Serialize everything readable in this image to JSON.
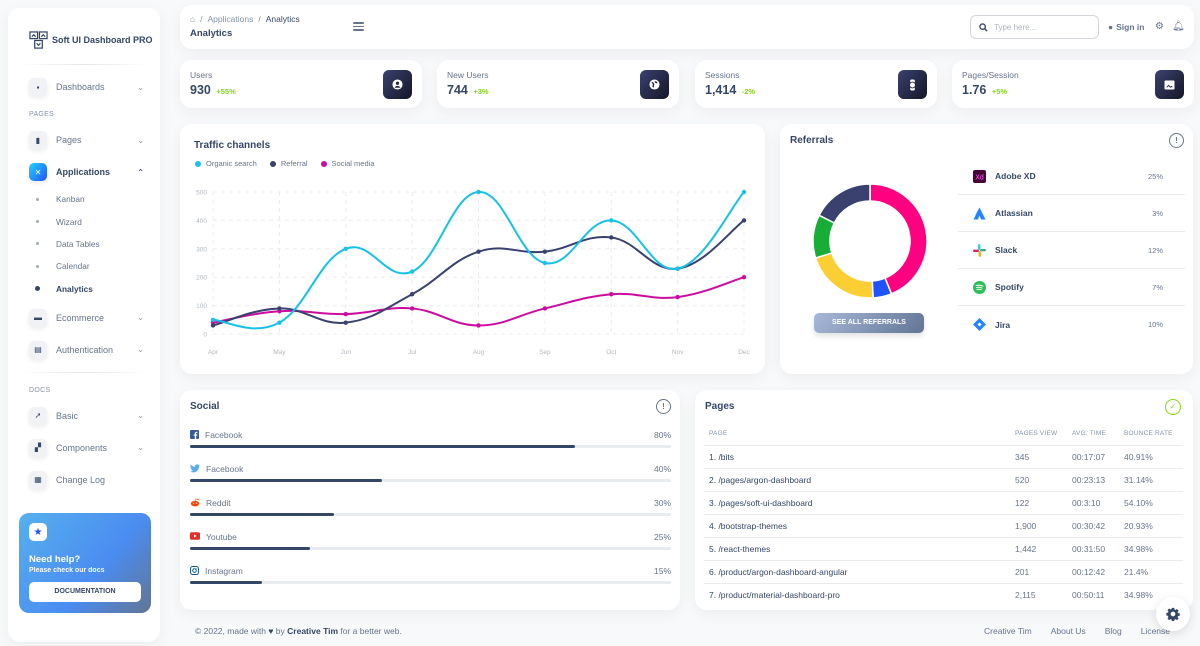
{
  "sidebar": {
    "brand": "Soft UI Dashboard PRO",
    "items_top": [
      {
        "label": "Dashboards",
        "icon": "shop-icon"
      }
    ],
    "section_pages": "PAGES",
    "pages_item": {
      "label": "Pages",
      "icon": "chart-icon"
    },
    "applications": {
      "label": "Applications",
      "icon": "tools-icon"
    },
    "applications_sub": [
      "Kanban",
      "Wizard",
      "Data Tables",
      "Calendar",
      "Analytics"
    ],
    "active_sub": "Analytics",
    "ecommerce": {
      "label": "Ecommerce",
      "icon": "basket-icon"
    },
    "authentication": {
      "label": "Authentication",
      "icon": "document-icon"
    },
    "section_docs": "DOCS",
    "basic": {
      "label": "Basic",
      "icon": "rocket-icon"
    },
    "components": {
      "label": "Components",
      "icon": "components-icon"
    },
    "changelog": {
      "label": "Change Log",
      "icon": "changelog-icon"
    },
    "help": {
      "title": "Need help?",
      "subtitle": "Please check our docs",
      "button": "DOCUMENTATION"
    }
  },
  "navbar": {
    "breadcrumb_parent": "Applications",
    "breadcrumb_current": "Analytics",
    "title": "Analytics",
    "search_placeholder": "Type here...",
    "signin": "Sign in"
  },
  "stats": [
    {
      "label": "Users",
      "value": "930",
      "change": "+55%",
      "icon": "user-icon"
    },
    {
      "label": "New Users",
      "value": "744",
      "change": "+3%",
      "icon": "globe-icon"
    },
    {
      "label": "Sessions",
      "value": "1,414",
      "change": "-2%",
      "icon": "watch-icon"
    },
    {
      "label": "Pages/Session",
      "value": "1.76",
      "change": "+5%",
      "icon": "image-icon"
    }
  ],
  "traffic": {
    "title": "Traffic channels"
  },
  "chart_data": {
    "type": "line",
    "title": "Traffic channels",
    "xlabel": "",
    "ylabel": "",
    "categories": [
      "Apr",
      "May",
      "Jun",
      "Jul",
      "Aug",
      "Sep",
      "Oct",
      "Nov",
      "Dec"
    ],
    "ylim": [
      0,
      500
    ],
    "yticks": [
      0,
      100,
      200,
      300,
      400,
      500
    ],
    "grid": true,
    "legend": "top-left",
    "series": [
      {
        "name": "Organic search",
        "color": "#17c1e8",
        "values": [
          50,
          40,
          300,
          220,
          500,
          250,
          400,
          230,
          500
        ]
      },
      {
        "name": "Referral",
        "color": "#3a416f",
        "values": [
          30,
          90,
          40,
          140,
          290,
          290,
          340,
          230,
          400
        ]
      },
      {
        "name": "Social media",
        "color": "#cb0c9f",
        "values": [
          40,
          80,
          70,
          90,
          30,
          90,
          140,
          130,
          200
        ]
      }
    ]
  },
  "referrals": {
    "title": "Referrals",
    "button": "SEE ALL REFERRALS",
    "donut": {
      "type": "pie",
      "values": [
        25,
        3,
        12,
        7,
        10
      ],
      "colors": [
        "#ff0080",
        "#2152ff",
        "#fbcf33",
        "#17ad37",
        "#3a416f"
      ]
    },
    "items": [
      {
        "name": "Adobe XD",
        "pct": "25%",
        "icon": "adobe-xd-icon"
      },
      {
        "name": "Atlassian",
        "pct": "3%",
        "icon": "atlassian-icon"
      },
      {
        "name": "Slack",
        "pct": "12%",
        "icon": "slack-icon"
      },
      {
        "name": "Spotify",
        "pct": "7%",
        "icon": "spotify-icon"
      },
      {
        "name": "Jira",
        "pct": "10%",
        "icon": "jira-icon"
      }
    ]
  },
  "social": {
    "title": "Social",
    "items": [
      {
        "name": "Facebook",
        "pct": "80%",
        "value": 80,
        "icon": "facebook-icon"
      },
      {
        "name": "Facebook",
        "pct": "40%",
        "value": 40,
        "icon": "twitter-icon"
      },
      {
        "name": "Reddit",
        "pct": "30%",
        "value": 30,
        "icon": "reddit-icon"
      },
      {
        "name": "Youtube",
        "pct": "25%",
        "value": 25,
        "icon": "youtube-icon"
      },
      {
        "name": "Instagram",
        "pct": "15%",
        "value": 15,
        "icon": "instagram-icon"
      }
    ]
  },
  "pages": {
    "title": "Pages",
    "headers": [
      "PAGE",
      "PAGES VIEW",
      "AVG. TIME",
      "BOUNCE RATE"
    ],
    "rows": [
      [
        "1. /bits",
        "345",
        "00:17:07",
        "40.91%"
      ],
      [
        "2. /pages/argon-dashboard",
        "520",
        "00:23:13",
        "31.14%"
      ],
      [
        "3. /pages/soft-ui-dashboard",
        "122",
        "00:3:10",
        "54.10%"
      ],
      [
        "4. /bootstrap-themes",
        "1,900",
        "00:30:42",
        "20.93%"
      ],
      [
        "5. /react-themes",
        "1,442",
        "00:31:50",
        "34.98%"
      ],
      [
        "6. /product/argon-dashboard-angular",
        "201",
        "00:12:42",
        "21.4%"
      ],
      [
        "7. /product/material-dashboard-pro",
        "2,115",
        "00:50:11",
        "34.98%"
      ]
    ]
  },
  "footer": {
    "copy_prefix": "© 2022, made with",
    "copy_by": "by",
    "author": "Creative Tim",
    "copy_suffix": "for a better web.",
    "links": [
      "Creative Tim",
      "About Us",
      "Blog",
      "License"
    ]
  }
}
